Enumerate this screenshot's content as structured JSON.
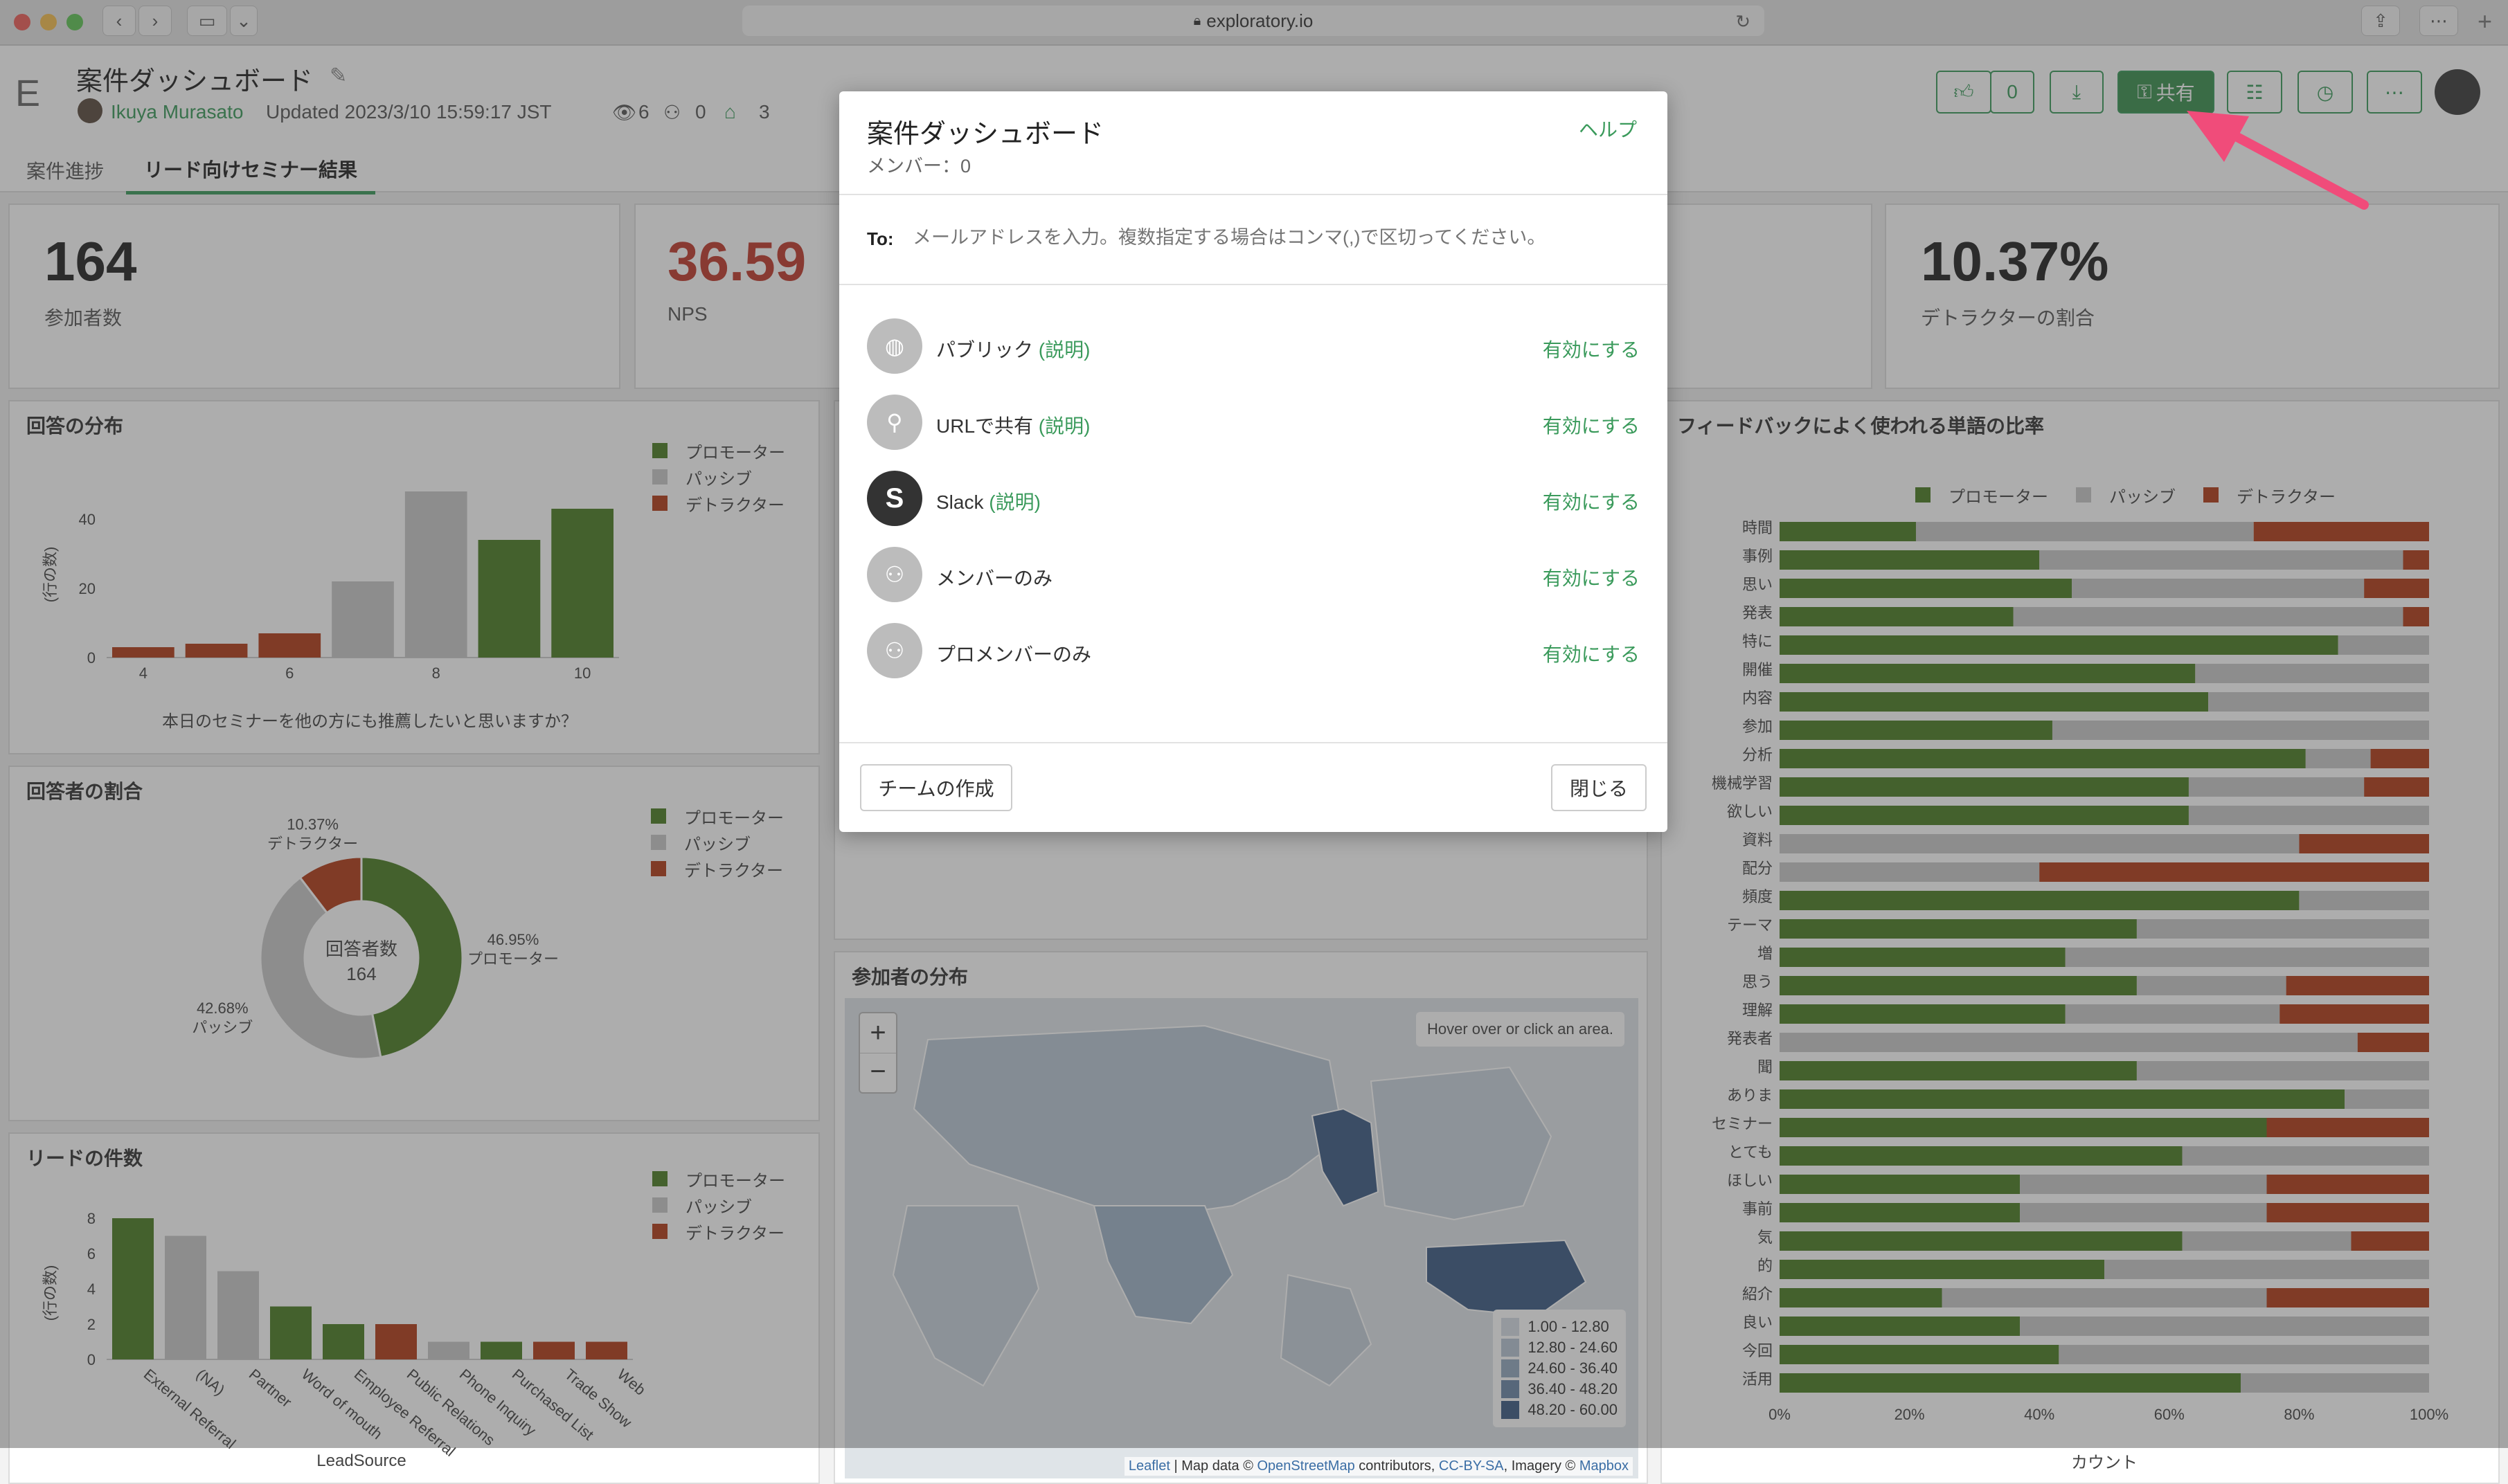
{
  "browser": {
    "url": "exploratory.io"
  },
  "header": {
    "logo": "E",
    "title": "案件ダッシュボード",
    "user": "Ikuya Murasato",
    "updated": "Updated 2023/3/10 15:59:17 JST",
    "views": "6",
    "shares": "0",
    "tags": "3",
    "like_count": "0",
    "share_label": "共有"
  },
  "tabs": [
    {
      "label": "案件進捗"
    },
    {
      "label": "リード向けセミナー結果"
    }
  ],
  "kpis": [
    {
      "value": "164",
      "label": "参加者数"
    },
    {
      "value": "36.59",
      "label": "NPS"
    },
    {
      "value": "10.37%",
      "label": "デトラクターの割合"
    }
  ],
  "legend": [
    "プロモーター",
    "パッシブ",
    "デトラクター"
  ],
  "colors": {
    "promoter": "#4a7d23",
    "passive": "#c9c9c9",
    "detractor": "#b23b17",
    "accent": "#3a9a5b",
    "nps": "#c0392b"
  },
  "panels": {
    "dist": "回答の分布",
    "ratio": "回答者の割合",
    "leads": "リードの件数",
    "words": "フィードバックによく使われる単語の比率",
    "map": "参加者の分布"
  },
  "chart_data": [
    {
      "type": "bar",
      "title": "回答の分布",
      "ylabel": "(行の数)",
      "xlabel": "本日のセミナーを他の方にも推薦したいと思いますか？",
      "x": [
        4,
        5,
        6,
        7,
        8,
        9,
        10
      ],
      "x_ticks": [
        "4",
        "6",
        "8",
        "10"
      ],
      "values": [
        3,
        4,
        7,
        22,
        48,
        34,
        43
      ],
      "group": [
        "デトラクター",
        "デトラクター",
        "デトラクター",
        "パッシブ",
        "パッシブ",
        "プロモーター",
        "プロモーター"
      ],
      "ylim": [
        0,
        50
      ],
      "y_ticks": [
        "0",
        "20",
        "40"
      ]
    },
    {
      "type": "pie",
      "title": "回答者の割合",
      "center_label": "回答者数",
      "center_value": "164",
      "slices": [
        {
          "name": "プロモーター",
          "value": 46.95,
          "label": "46.95%"
        },
        {
          "name": "パッシブ",
          "value": 42.68,
          "label": "42.68%"
        },
        {
          "name": "デトラクター",
          "value": 10.37,
          "label": "10.37%"
        }
      ]
    },
    {
      "type": "bar",
      "title": "リードの件数",
      "ylabel": "(行の数)",
      "xlabel": "LeadSource",
      "categories": [
        "External Referral",
        "(NA)",
        "Partner",
        "Word of mouth",
        "Employee Referral",
        "Public Relations",
        "Phone Inquiry",
        "Purchased List",
        "Trade Show",
        "Web"
      ],
      "values": [
        8,
        7,
        5,
        3,
        2,
        2,
        1,
        1,
        1,
        1
      ],
      "group": [
        "プロモーター",
        "パッシブ",
        "パッシブ",
        "プロモーター",
        "プロモーター",
        "デトラクター",
        "パッシブ",
        "プロモーター",
        "デトラクター",
        "デトラクター"
      ],
      "ylim": [
        0,
        8
      ],
      "y_ticks": [
        "0",
        "2",
        "4",
        "6",
        "8"
      ]
    },
    {
      "type": "bar",
      "title": "フィードバックによく使われる単語の比率",
      "xlabel": "カウント",
      "x_ticks": [
        "0%",
        "20%",
        "40%",
        "60%",
        "80%",
        "100%"
      ],
      "categories": [
        "時間",
        "事例",
        "思い",
        "発表",
        "特に",
        "開催",
        "内容",
        "参加",
        "分析",
        "機械学習",
        "欲しい",
        "資料",
        "配分",
        "頻度",
        "テーマ",
        "増",
        "思う",
        "理解",
        "発表者",
        "聞",
        "ありま",
        "セミナー",
        "とても",
        "ほしい",
        "事前",
        "気",
        "的",
        "紹介",
        "良い",
        "今回",
        "活用"
      ],
      "series": [
        {
          "name": "プロモーター",
          "values": [
            21,
            40,
            45,
            36,
            86,
            64,
            66,
            42,
            81,
            63,
            63,
            0,
            0,
            80,
            55,
            44,
            55,
            44,
            0,
            55,
            87,
            75,
            62,
            37,
            37,
            62,
            50,
            25,
            37,
            43,
            71
          ]
        },
        {
          "name": "パッシブ",
          "values": [
            52,
            56,
            45,
            60,
            14,
            36,
            34,
            58,
            10,
            27,
            37,
            80,
            40,
            20,
            45,
            56,
            23,
            33,
            89,
            45,
            13,
            0,
            38,
            38,
            38,
            26,
            50,
            50,
            63,
            57,
            29
          ]
        },
        {
          "name": "デトラクター",
          "values": [
            27,
            4,
            10,
            4,
            0,
            0,
            0,
            0,
            9,
            10,
            0,
            20,
            60,
            0,
            0,
            0,
            22,
            23,
            11,
            0,
            0,
            25,
            0,
            25,
            25,
            12,
            0,
            25,
            0,
            0,
            0
          ]
        }
      ]
    },
    {
      "type": "heatmap",
      "title": "参加者の分布",
      "legend": [
        "1.00 - 12.80",
        "12.80 - 24.60",
        "24.60 - 36.40",
        "36.40 - 48.20",
        "48.20 - 60.00"
      ]
    }
  ],
  "map": {
    "hover": "Hover over or click an area.",
    "attribution_parts": [
      "Leaflet",
      "| Map data ©",
      "OpenStreetMap",
      "contributors,",
      "CC-BY-SA",
      ", Imagery ©",
      "Mapbox"
    ]
  },
  "modal": {
    "title": "案件ダッシュボード",
    "members": "メンバー：0",
    "help": "ヘルプ",
    "to_label": "To:",
    "to_placeholder": "メールアドレスを入力。複数指定する場合はコンマ(,)で区切ってください。",
    "options": [
      {
        "label": "パブリック",
        "link": "(説明)",
        "action": "有効にする"
      },
      {
        "label": "URLで共有",
        "link": "(説明)",
        "action": "有効にする"
      },
      {
        "label": "Slack",
        "link": "(説明)",
        "action": "有効にする"
      },
      {
        "label": "メンバーのみ",
        "link": "",
        "action": "有効にする"
      },
      {
        "label": "プロメンバーのみ",
        "link": "",
        "action": "有効にする"
      }
    ],
    "create_team": "チームの作成",
    "close": "閉じる"
  }
}
